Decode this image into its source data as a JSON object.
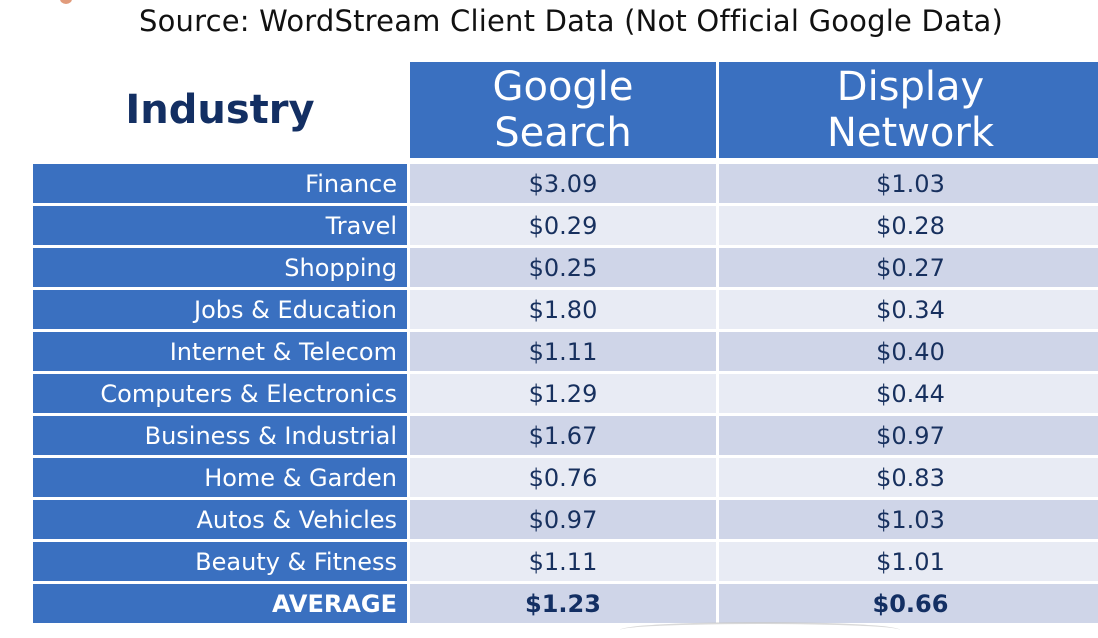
{
  "title": "Source: WordStream Client Data (Not Official Google Data)",
  "table": {
    "headers": {
      "industry": "Industry",
      "google_search": [
        "Google",
        "Search"
      ],
      "display_network": [
        "Display",
        "Network"
      ]
    },
    "rows": [
      {
        "industry": "Finance",
        "google_search": "$3.09",
        "display_network": "$1.03"
      },
      {
        "industry": "Travel",
        "google_search": "$0.29",
        "display_network": "$0.28"
      },
      {
        "industry": "Shopping",
        "google_search": "$0.25",
        "display_network": "$0.27"
      },
      {
        "industry": "Jobs & Education",
        "google_search": "$1.80",
        "display_network": "$0.34"
      },
      {
        "industry": "Internet & Telecom",
        "google_search": "$1.11",
        "display_network": "$0.40"
      },
      {
        "industry": "Computers & Electronics",
        "google_search": "$1.29",
        "display_network": "$0.44"
      },
      {
        "industry": "Business & Industrial",
        "google_search": "$1.67",
        "display_network": "$0.97"
      },
      {
        "industry": "Home & Garden",
        "google_search": "$0.76",
        "display_network": "$0.83"
      },
      {
        "industry": "Autos & Vehicles",
        "google_search": "$0.97",
        "display_network": "$1.03"
      },
      {
        "industry": "Beauty & Fitness",
        "google_search": "$1.11",
        "display_network": "$1.01"
      }
    ],
    "average": {
      "industry": "AVERAGE",
      "google_search": "$1.23",
      "display_network": "$0.66"
    }
  },
  "colors": {
    "header_blue": "#3a70c0",
    "industry_heading": "#132f63",
    "row_dark": "#cfd5e8",
    "row_light": "#e8ebf4",
    "value_text": "#17305e"
  }
}
